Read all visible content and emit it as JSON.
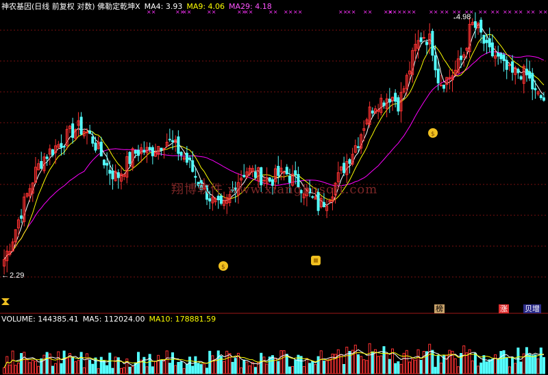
{
  "header": {
    "title": "神农基因(日线 前复权 对数) 佛勒定乾坤X",
    "ma4_label": "MA4: 3.93",
    "ma9_label": "MA9: 4.06",
    "ma29_label": "MA29: 4.18"
  },
  "volume_header": {
    "volume_label": "VOLUME: 144385.41",
    "ma5_label": "MA5: 112024.00",
    "ma10_label": "MA10: 178881.59"
  },
  "watermark": "翔博软件 www.xiangbosoft.com",
  "annotations": {
    "high_label": "4.98",
    "low_label": "2.29",
    "tag_bang": "榜",
    "tag_zhang": "涨",
    "tag_zeng": "贝增"
  },
  "colors": {
    "background": "#000000",
    "up": "#ff3232",
    "down": "#54ffff",
    "ma4": "#ffffff",
    "ma9": "#ffff00",
    "ma29": "#ff00ff",
    "grid": "#7a1010"
  },
  "icons": [
    "money-bag-icon",
    "money-bag-icon",
    "gold-ingot-icon",
    "hourglass-icon"
  ],
  "chart_data": {
    "type": "candlestick",
    "title": "神农基因(日线 前复权 对数)",
    "y_scale": "log",
    "ylim": [
      2.2,
      5.1
    ],
    "price_path": [
      2.4,
      2.55,
      2.75,
      2.95,
      3.15,
      3.28,
      3.35,
      3.42,
      3.5,
      3.58,
      3.55,
      3.45,
      3.3,
      3.15,
      3.08,
      3.18,
      3.3,
      3.35,
      3.32,
      3.38,
      3.45,
      3.4,
      3.3,
      3.2,
      3.05,
      2.95,
      2.85,
      2.78,
      2.9,
      3.05,
      3.15,
      3.12,
      3.08,
      3.05,
      3.1,
      3.12,
      3.05,
      3.0,
      2.9,
      2.82,
      2.88,
      3.0,
      3.15,
      3.3,
      3.45,
      3.7,
      3.85,
      3.9,
      3.95,
      3.85,
      4.15,
      4.55,
      4.75,
      4.65,
      4.1,
      4.15,
      4.25,
      4.45,
      4.9,
      4.8,
      4.5,
      4.45,
      4.3,
      4.2,
      4.25,
      4.18,
      3.95,
      3.9
    ],
    "high": 4.98,
    "low": 2.29,
    "volume_ylim": [
      0,
      600000
    ]
  }
}
